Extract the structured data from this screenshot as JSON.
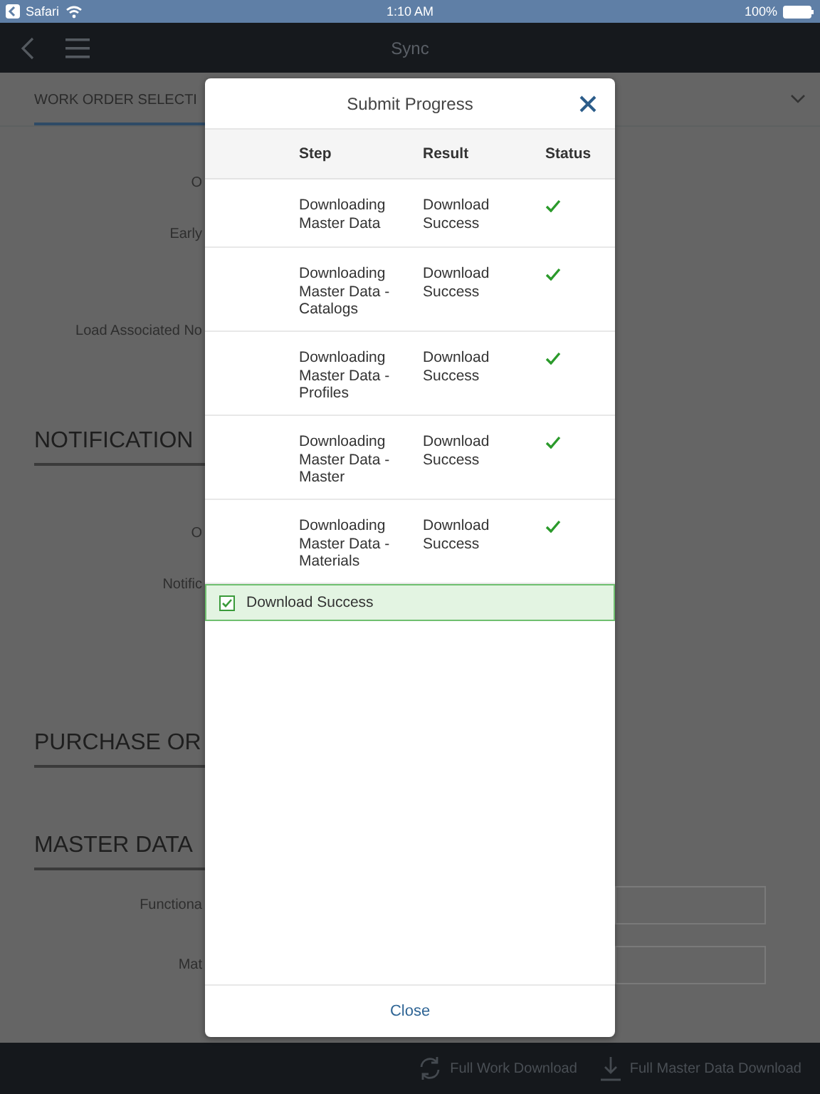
{
  "status_bar": {
    "back_app": "Safari",
    "time": "1:10 AM",
    "battery": "100%"
  },
  "nav_bar": {
    "title": "Sync"
  },
  "background": {
    "tab": "WORK ORDER SELECTI",
    "items": [
      {
        "kind": "label",
        "text": "O"
      },
      {
        "kind": "label",
        "text": "Early"
      },
      {
        "kind": "label",
        "text": "Load Associated No"
      },
      {
        "kind": "heading",
        "text": "NOTIFICATION"
      },
      {
        "kind": "label",
        "text": "O"
      },
      {
        "kind": "label",
        "text": "Notific"
      },
      {
        "kind": "heading",
        "text": "PURCHASE OR"
      },
      {
        "kind": "heading",
        "text": "MASTER DATA"
      },
      {
        "kind": "field",
        "text": "Functiona"
      },
      {
        "kind": "field",
        "text": "Mat"
      }
    ]
  },
  "dialog": {
    "title": "Submit Progress",
    "columns": [
      "Step",
      "Result",
      "Status"
    ],
    "rows": [
      {
        "step": "Downloading Master Data",
        "result": "Download Success",
        "done": true
      },
      {
        "step": "Downloading Master Data - Catalogs",
        "result": "Download Success",
        "done": true
      },
      {
        "step": "Downloading Master Data - Profiles",
        "result": "Download Success",
        "done": true
      },
      {
        "step": "Downloading Master Data - Master",
        "result": "Download Success",
        "done": true
      },
      {
        "step": "Downloading Master Data - Materials",
        "result": "Download Success",
        "done": true
      }
    ],
    "message": {
      "text": "Download Success",
      "checked": true
    },
    "close": "Close"
  },
  "bottom_bar": [
    "Full Work Download",
    "Full Master Data Download"
  ]
}
